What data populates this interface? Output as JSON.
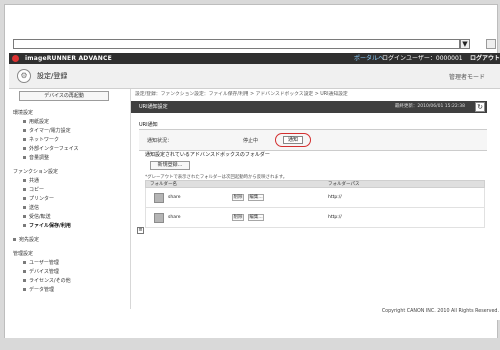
{
  "browser": {
    "address_value": "",
    "dropdown_icon": "chevron-down"
  },
  "header": {
    "brand": "imageRUNNER ADVANCE",
    "portal_link": "ポータルへ",
    "login_user_label": "ログインユーザー：0000001",
    "logout": "ログアウト"
  },
  "page": {
    "title": "設定/登録",
    "admin_menu": "管理者モード"
  },
  "sidebar": {
    "restart_button": "デバイスの再起動",
    "sections": [
      {
        "label": "環境設定",
        "items": [
          "用紙設定",
          "タイマー/電力設定",
          "ネットワーク",
          "外部インターフェイス",
          "音量調整"
        ]
      },
      {
        "label": "ファンクション設定",
        "items": [
          "共通",
          "コピー",
          "プリンター",
          "送信",
          "受信/転送",
          "ファイル保存/利用"
        ]
      },
      {
        "label": "宛先設定",
        "items": []
      },
      {
        "label": "管理設定",
        "items": [
          "ユーザー管理",
          "デバイス管理",
          "ライセンス/その他",
          "データ管理"
        ]
      }
    ],
    "active_item": "ファイル保存/利用"
  },
  "breadcrumb": {
    "path": "設定/登録：ファンクション設定：ファイル保存/利用 > アドバンスドボックス設定 > URI通知設定",
    "current": "URI通知設定"
  },
  "content": {
    "header_title": "URI通知設定",
    "last_updated": "最終更新：2010/06/01 15:22:38",
    "section_label": "URI通知",
    "status_label": "通知状況：",
    "status_value": "停止中",
    "notify_button": "通知",
    "folders_title": "通知設定されているアドバンスドボックスのフォルダー",
    "register_button": "新規登録...",
    "note": "*グレーアウトで表示されたフォルダーは次回起動時から反映されます。",
    "table": {
      "columns": [
        "フォルダー名",
        "フォルダーパス"
      ],
      "rows": [
        {
          "name": "share",
          "delete": "削除",
          "edit": "編集...",
          "path": "http://"
        },
        {
          "name": "share",
          "delete": "削除",
          "edit": "編集...",
          "path": "http://"
        }
      ]
    }
  },
  "footer": {
    "copyright": "Copyright CANON INC. 2010 All Rights Reserved."
  },
  "colors": {
    "accent_highlight": "#d32f2f",
    "header_dark": "#2f2f2f"
  }
}
